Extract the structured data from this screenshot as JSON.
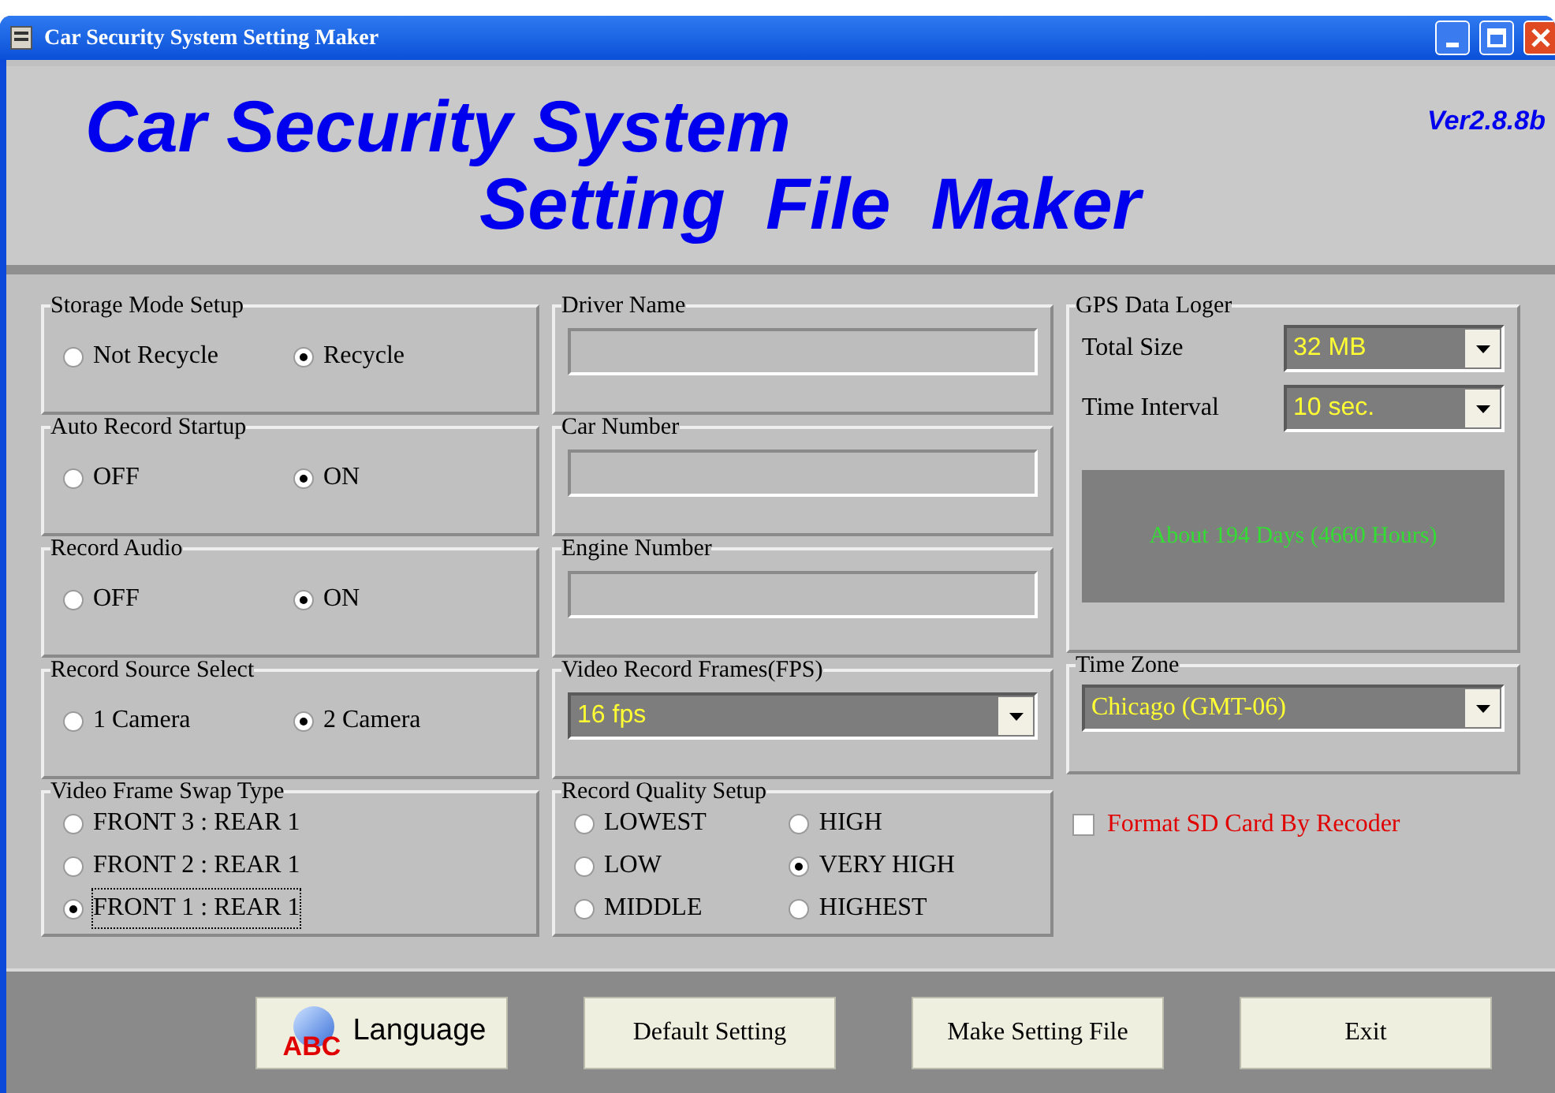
{
  "window": {
    "title": "Car Security System Setting Maker"
  },
  "banner": {
    "line1": "Car Security System",
    "line2": "Setting  File  Maker",
    "version": "Ver2.8.8b"
  },
  "radio_groups": [
    {
      "title": "Storage Mode Setup",
      "kind": "row",
      "options": [
        {
          "label": "Not Recycle",
          "selected": false
        },
        {
          "label": "Recycle",
          "selected": true
        }
      ]
    },
    {
      "title": "Auto Record Startup",
      "kind": "row",
      "options": [
        {
          "label": "OFF",
          "selected": false
        },
        {
          "label": "ON",
          "selected": true
        }
      ]
    },
    {
      "title": "Record Audio",
      "kind": "row",
      "options": [
        {
          "label": "OFF",
          "selected": false
        },
        {
          "label": "ON",
          "selected": true
        }
      ]
    },
    {
      "title": "Record Source Select",
      "kind": "row",
      "options": [
        {
          "label": "1 Camera",
          "selected": false
        },
        {
          "label": "2 Camera",
          "selected": true
        }
      ]
    },
    {
      "title": "Video Frame Swap Type",
      "kind": "column",
      "options": [
        {
          "label": "FRONT 3 : REAR 1",
          "selected": false,
          "focused": false
        },
        {
          "label": "FRONT 2 : REAR 1",
          "selected": false,
          "focused": false
        },
        {
          "label": "FRONT 1 : REAR 1",
          "selected": true,
          "focused": true
        }
      ]
    }
  ],
  "text_fields": [
    {
      "label": "Driver Name"
    },
    {
      "label": "Car Number"
    },
    {
      "label": "Engine Number"
    }
  ],
  "fps": {
    "label": "Video Record Frames(FPS)",
    "value": "16 fps"
  },
  "quality": {
    "title": "Record Quality Setup",
    "options": [
      {
        "label": "LOWEST",
        "selected": false
      },
      {
        "label": "LOW",
        "selected": false
      },
      {
        "label": "MIDDLE",
        "selected": false
      },
      {
        "label": "HIGH",
        "selected": false
      },
      {
        "label": "VERY HIGH",
        "selected": true
      },
      {
        "label": "HIGHEST",
        "selected": false
      }
    ]
  },
  "gps": {
    "title": "GPS Data Loger",
    "total_size": {
      "label": "Total Size",
      "value": "32 MB"
    },
    "time_interval": {
      "label": "Time Interval",
      "value": "10 sec."
    },
    "estimate": "About 194 Days (4660 Hours)"
  },
  "time_zone": {
    "title": "Time Zone",
    "value": "Chicago (GMT-06)"
  },
  "format_sd": {
    "label": "Format SD Card By Recoder",
    "checked": false
  },
  "buttons": [
    {
      "label": "Language",
      "icon_text": "ABC"
    },
    {
      "label": "Default Setting"
    },
    {
      "label": "Make Setting File"
    },
    {
      "label": "Exit"
    }
  ]
}
